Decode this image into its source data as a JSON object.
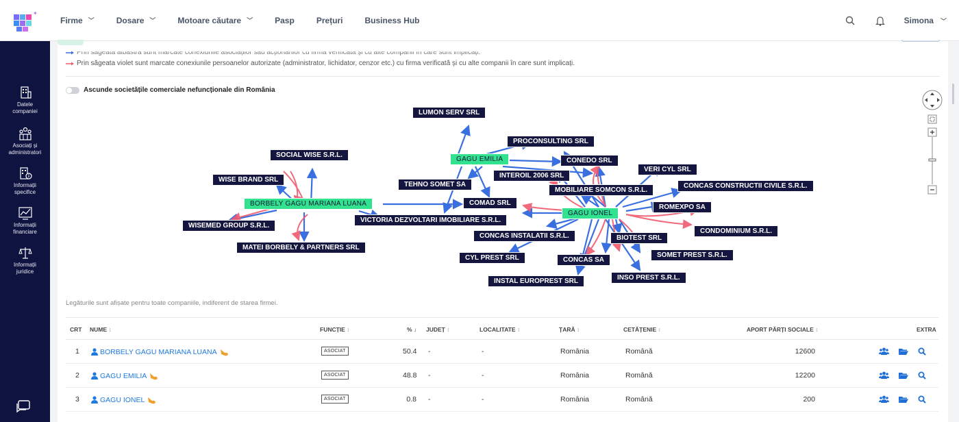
{
  "nav": {
    "items": [
      {
        "label": "Firme",
        "has_menu": true
      },
      {
        "label": "Dosare",
        "has_menu": true
      },
      {
        "label": "Motoare căutare",
        "has_menu": true
      },
      {
        "label": "Pasp",
        "has_menu": false
      },
      {
        "label": "Prețuri",
        "has_menu": false
      },
      {
        "label": "Business Hub",
        "has_menu": false
      }
    ],
    "user": "Simona"
  },
  "sidebar": {
    "items": [
      {
        "label1": "Datele",
        "label2": "companiei",
        "icon": "building-icon"
      },
      {
        "label1": "Asociați și",
        "label2": "administratori",
        "icon": "people-icon"
      },
      {
        "label1": "Informații",
        "label2": "specifice",
        "icon": "info-building-icon"
      },
      {
        "label1": "Informații",
        "label2": "financiare",
        "icon": "chart-icon"
      },
      {
        "label1": "Informații",
        "label2": "juridice",
        "icon": "scales-icon"
      }
    ]
  },
  "legend": {
    "blue_text": "Prin săgeata albastră sunt marcate conexiunile asociaților sau acționarilor cu firma verificată și cu alte companii în care sunt implicați.",
    "violet_text": "Prin săgeata violet sunt marcate conexiunile persoanelor autorizate (administrator, lichidator, cenzor etc.) cu firma verificată și cu alte companii în care sunt implicați.",
    "blue_color": "#3a6fe0",
    "violet_color": "#f05a6e"
  },
  "toggle": {
    "label": "Ascunde societățile comerciale nefuncționale din România",
    "on": false
  },
  "graph": {
    "persons": [
      "BORBELY GAGU MARIANA LUANA",
      "GAGU EMILIA",
      "GAGU IONEL"
    ],
    "companies": [
      "LUMON SERV SRL",
      "PROCONSULTING SRL",
      "SOCIAL WISE S.R.L.",
      "CONEDO SRL",
      "VERI CYL SRL",
      "INTEROIL 2006 SRL",
      "WISE BRAND SRL",
      "TEHNO SOMET SA",
      "MOBILIARE SOMCON S.R.L.",
      "CONCAS CONSTRUCTII CIVILE S.R.L.",
      "COMAD SRL",
      "ROMEXPO SA",
      "WISEMED GROUP S.R.L.",
      "VICTORIA DEZVOLTARI IMOBILIARE S.R.L.",
      "CONDOMINIUM S.R.L.",
      "CONCAS INSTALATII S.R.L.",
      "BIOTEST SRL",
      "MATEI BORBELY & PARTNERS SRL",
      "SOMET PREST S.R.L.",
      "CYL PREST SRL",
      "CONCAS  SA",
      "INSO PREST S.R.L.",
      "INSTAL EUROPREST SRL"
    ]
  },
  "note": "Legăturile sunt afișate pentru toate companiile, indiferent de starea firmei.",
  "table": {
    "headers": {
      "crt": "CRT",
      "nume": "NUME",
      "functie": "FUNCȚIE",
      "pct": "%",
      "judet": "JUDEȚ",
      "localitate": "LOCALITATE",
      "tara": "ȚARĂ",
      "cetatenie": "CETĂȚENIE",
      "aport": "APORT PĂRȚI SOCIALE",
      "extra": "EXTRA"
    },
    "rows": [
      {
        "crt": "1",
        "nume": "BORBELY GAGU MARIANA LUANA",
        "functie": "ASOCIAT",
        "pct": "50.4",
        "judet": "-",
        "localitate": "-",
        "tara": "România",
        "cetatenie": "Română",
        "aport": "12600"
      },
      {
        "crt": "2",
        "nume": "GAGU EMILIA",
        "functie": "ASOCIAT",
        "pct": "48.8",
        "judet": "-",
        "localitate": "-",
        "tara": "România",
        "cetatenie": "Română",
        "aport": "12200"
      },
      {
        "crt": "3",
        "nume": "GAGU IONEL",
        "functie": "ASOCIAT",
        "pct": "0.8",
        "judet": "-",
        "localitate": "-",
        "tara": "România",
        "cetatenie": "Română",
        "aport": "200"
      }
    ]
  }
}
